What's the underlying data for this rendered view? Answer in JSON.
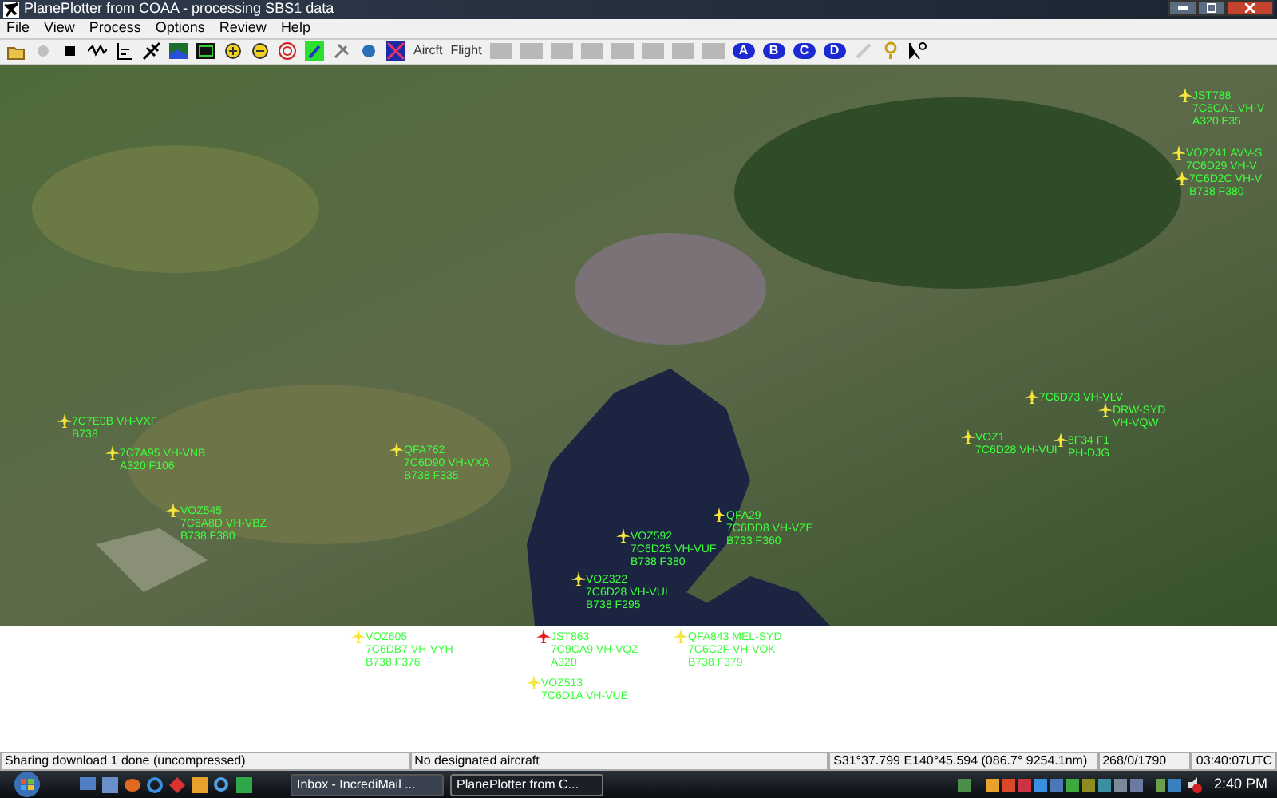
{
  "window": {
    "title": "PlanePlotter from COAA - processing SBS1 data"
  },
  "menu": [
    "File",
    "View",
    "Process",
    "Options",
    "Review",
    "Help"
  ],
  "toolbar": [
    {
      "kind": "icon",
      "disabled": false
    },
    {
      "kind": "icon",
      "disabled": true
    },
    {
      "kind": "icon",
      "disabled": false
    },
    {
      "kind": "icon",
      "disabled": false
    },
    {
      "kind": "icon",
      "disabled": false
    },
    {
      "kind": "icon",
      "disabled": false
    },
    {
      "kind": "icon",
      "disabled": false
    },
    {
      "kind": "icon",
      "disabled": false
    },
    {
      "kind": "icon",
      "disabled": false
    },
    {
      "kind": "icon",
      "disabled": false
    },
    {
      "kind": "icon",
      "disabled": false
    },
    {
      "kind": "icon",
      "disabled": false
    },
    {
      "kind": "icon",
      "disabled": false
    },
    {
      "kind": "icon",
      "disabled": false
    },
    {
      "kind": "icon",
      "disabled": false
    },
    {
      "kind": "text",
      "label": "Aircft",
      "disabled": false
    },
    {
      "kind": "text",
      "label": "Flight",
      "disabled": false
    },
    {
      "kind": "blank",
      "disabled": true
    },
    {
      "kind": "blank",
      "disabled": true
    },
    {
      "kind": "blank",
      "disabled": true
    },
    {
      "kind": "blank",
      "disabled": true
    },
    {
      "kind": "blank",
      "disabled": true
    },
    {
      "kind": "blank",
      "disabled": true
    },
    {
      "kind": "blank",
      "disabled": true
    },
    {
      "kind": "blank",
      "disabled": true
    },
    {
      "kind": "letter",
      "label": "A",
      "disabled": false
    },
    {
      "kind": "letter",
      "label": "B",
      "disabled": false
    },
    {
      "kind": "letter",
      "label": "C",
      "disabled": false
    },
    {
      "kind": "letter",
      "label": "D",
      "disabled": false
    },
    {
      "kind": "icon",
      "disabled": true
    },
    {
      "kind": "icon",
      "disabled": false
    },
    {
      "kind": "icon",
      "disabled": false
    }
  ],
  "aircraft": [
    {
      "lines": [
        "JST788",
        "7C6CA1 VH-V",
        "A320 F35"
      ],
      "color": "#f5e63c"
    },
    {
      "lines": [
        "VOZ241 AVV-S",
        "7C6D29 VH-V"
      ],
      "color": "#f5e63c"
    },
    {
      "lines": [
        "7C6D2C VH-V",
        "B738 F380"
      ],
      "color": "#f5e63c"
    },
    {
      "lines": [
        "7C7E0B VH-VXF",
        "B738"
      ],
      "color": "#f5e63c"
    },
    {
      "lines": [
        "7C7A95 VH-VNB",
        "A320 F106"
      ],
      "color": "#f5e63c"
    },
    {
      "lines": [
        "QFA762",
        "7C6D90 VH-VXA",
        "B738 F335"
      ],
      "color": "#f5e63c"
    },
    {
      "lines": [
        "VOZ545",
        "7C6A8D VH-VBZ",
        "B738 F380"
      ],
      "color": "#f5e63c"
    },
    {
      "lines": [
        "VOZ592",
        "7C6D25 VH-VUF",
        "B738 F380"
      ],
      "color": "#f5e63c"
    },
    {
      "lines": [
        "QFA29",
        "7C6DD8 VH-VZE",
        "B733 F360"
      ],
      "color": "#f5e63c"
    },
    {
      "lines": [
        "VOZ322",
        "7C6D28 VH-VUI",
        "B738 F295"
      ],
      "color": "#f5e63c"
    },
    {
      "lines": [
        "VOZ605",
        "7C6DB7 VH-VYH",
        "B738 F376"
      ],
      "color": "#f5e63c"
    },
    {
      "lines": [
        "JST863",
        "7C9CA9 VH-VQZ",
        "A320"
      ],
      "color": "#e02020"
    },
    {
      "lines": [
        "QFA843 MEL-SYD",
        "7C6C2F VH-VOK",
        "B738 F379"
      ],
      "color": "#f5e63c"
    },
    {
      "lines": [
        "VOZ513",
        "7C6D1A VH-VUE"
      ],
      "color": "#f5e63c"
    },
    {
      "lines": [
        "7C6D73 VH-VLV"
      ],
      "color": "#f5e63c"
    },
    {
      "lines": [
        "DRW-SYD",
        "VH-VQW"
      ],
      "color": "#f5e63c"
    },
    {
      "lines": [
        "VOZ1",
        "7C6D28 VH-VUI"
      ],
      "color": "#f5e63c"
    },
    {
      "lines": [
        "8F34 F1",
        "PH-DJG"
      ],
      "color": "#f5e63c"
    }
  ],
  "status_bar": [
    "Sharing download 1 done (uncompressed)",
    "No designated aircraft",
    "S31°37.799 E140°45.594 (086.7° 9254.1nm)",
    "268/0/1790",
    "03:40:07UTC"
  ],
  "taskbar": {
    "tasks": [
      {
        "label": "Inbox - IncrediMail ...",
        "selected": false
      },
      {
        "label": "PlanePlotter from C...",
        "selected": true
      }
    ],
    "clock": "2:40 PM"
  }
}
